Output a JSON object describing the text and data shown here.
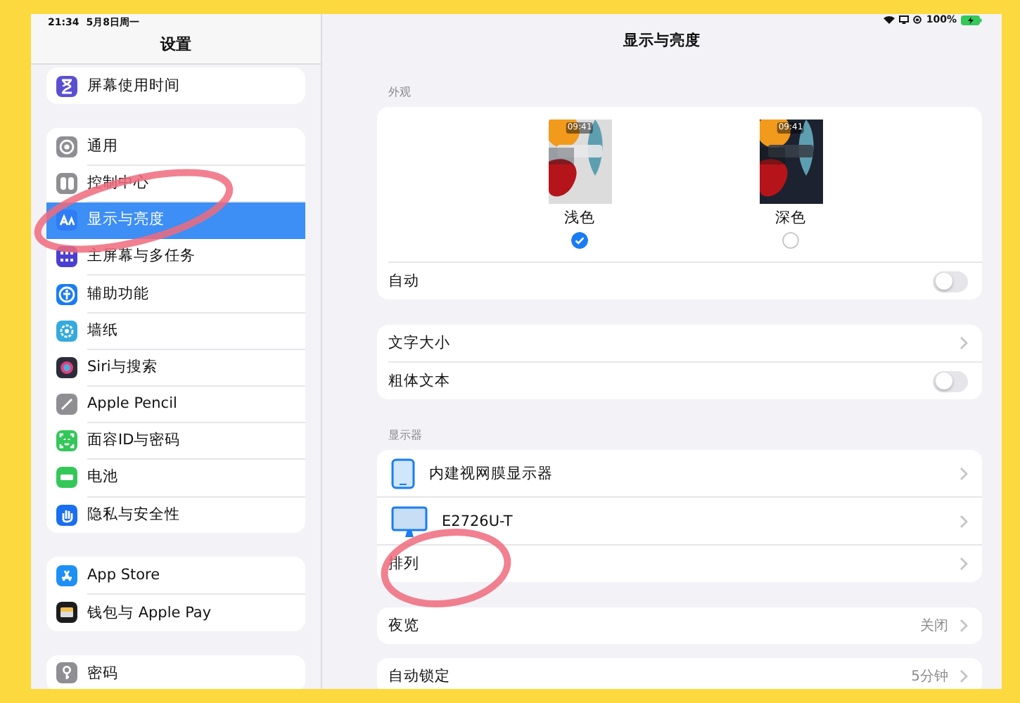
{
  "status_bar": {
    "time": "21:34",
    "date": "5月8日周一",
    "battery": "100%"
  },
  "sidebar": {
    "title": "设置",
    "groups": [
      {
        "items": [
          {
            "label": "屏幕使用时间",
            "color": "#5b4fd0",
            "selected": false
          }
        ]
      },
      {
        "items": [
          {
            "label": "通用",
            "color": "#8e8e93",
            "selected": false
          },
          {
            "label": "控制中心",
            "color": "#8e8e93",
            "selected": false
          },
          {
            "label": "显示与亮度",
            "color": "#2f7cf6",
            "selected": true
          },
          {
            "label": "主屏幕与多任务",
            "color": "#4a3fd1",
            "selected": false
          },
          {
            "label": "辅助功能",
            "color": "#1a7cf2",
            "selected": false
          },
          {
            "label": "墙纸",
            "color": "#35aadc",
            "selected": false
          },
          {
            "label": "Siri与搜索",
            "color": "#2b2b3a",
            "selected": false
          },
          {
            "label": "Apple Pencil",
            "color": "#8e8e93",
            "selected": false
          },
          {
            "label": "面容ID与密码",
            "color": "#34c759",
            "selected": false
          },
          {
            "label": "电池",
            "color": "#34c759",
            "selected": false
          },
          {
            "label": "隐私与安全性",
            "color": "#1a6ff0",
            "selected": false
          }
        ]
      },
      {
        "items": [
          {
            "label": "App Store",
            "color": "#1e8ff5",
            "selected": false
          },
          {
            "label": "钱包与 Apple Pay",
            "color": "#1c1c1e",
            "selected": false
          }
        ]
      },
      {
        "items": [
          {
            "label": "密码",
            "color": "#8e8e93",
            "selected": false
          }
        ]
      }
    ]
  },
  "detail": {
    "title": "显示与亮度",
    "appearance": {
      "header": "外观",
      "options": [
        {
          "label": "浅色",
          "preview_time": "09:41",
          "selected": true
        },
        {
          "label": "深色",
          "preview_time": "09:41",
          "selected": false
        }
      ],
      "automatic": {
        "label": "自动",
        "on": false
      }
    },
    "sections": [
      {
        "rows": [
          {
            "kind": "link",
            "label": "文字大小"
          },
          {
            "kind": "toggle",
            "label": "粗体文本",
            "on": false
          }
        ]
      },
      {
        "header": "显示器",
        "rows": [
          {
            "kind": "tablet",
            "label": "内建视网膜显示器"
          },
          {
            "kind": "monitor",
            "label": "E2726U-T"
          },
          {
            "kind": "link",
            "label": "排列"
          }
        ]
      },
      {
        "rows": [
          {
            "kind": "link",
            "label": "夜览",
            "value": "关闭"
          }
        ]
      },
      {
        "rows": [
          {
            "kind": "link",
            "label": "自动锁定",
            "value": "5分钟"
          }
        ]
      }
    ]
  }
}
